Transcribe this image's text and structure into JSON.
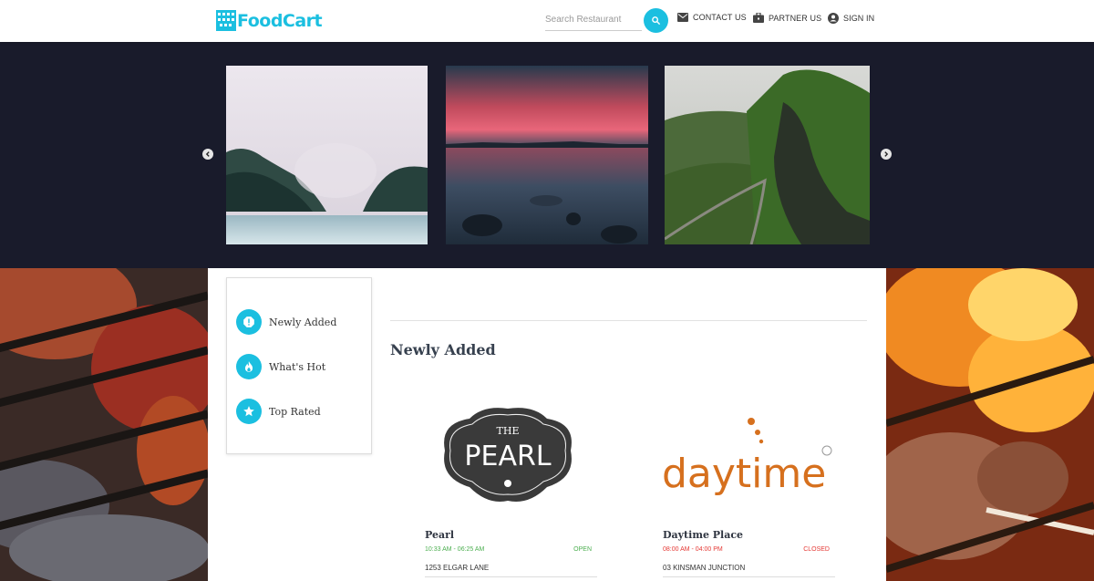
{
  "header": {
    "logo_text": "FoodCart",
    "search_placeholder": "Search Restaurant",
    "nav": [
      {
        "label": "CONTACT US",
        "icon": "mail-icon"
      },
      {
        "label": "PARTNER US",
        "icon": "briefcase-icon"
      },
      {
        "label": "SIGN IN",
        "icon": "account-icon"
      }
    ]
  },
  "carousel": {
    "slides": [
      "misty-forest-lake",
      "sunset-lake",
      "green-mountain-road"
    ]
  },
  "side_menu": {
    "items": [
      {
        "label": "Newly Added",
        "icon": "alert-icon"
      },
      {
        "label": "What's Hot",
        "icon": "fire-icon"
      },
      {
        "label": "Top Rated",
        "icon": "star-icon"
      }
    ]
  },
  "main": {
    "section_title": "Newly Added",
    "restaurants": [
      {
        "name": "Pearl",
        "hours": "10:33 AM - 06:25 AM",
        "status": "OPEN",
        "address": "1253 ELGAR LANE",
        "logo_text": "PEARL",
        "logo_prefix": "THE",
        "status_color": "#4caf50"
      },
      {
        "name": "Daytime Place",
        "hours": "08:00 AM - 04:00 PM",
        "status": "CLOSED",
        "address": "03 KINSMAN JUNCTION",
        "logo_text": "daytime",
        "status_color": "#e53935"
      }
    ]
  },
  "colors": {
    "accent": "#1bbfe0",
    "dark_band": "#191b2b"
  }
}
